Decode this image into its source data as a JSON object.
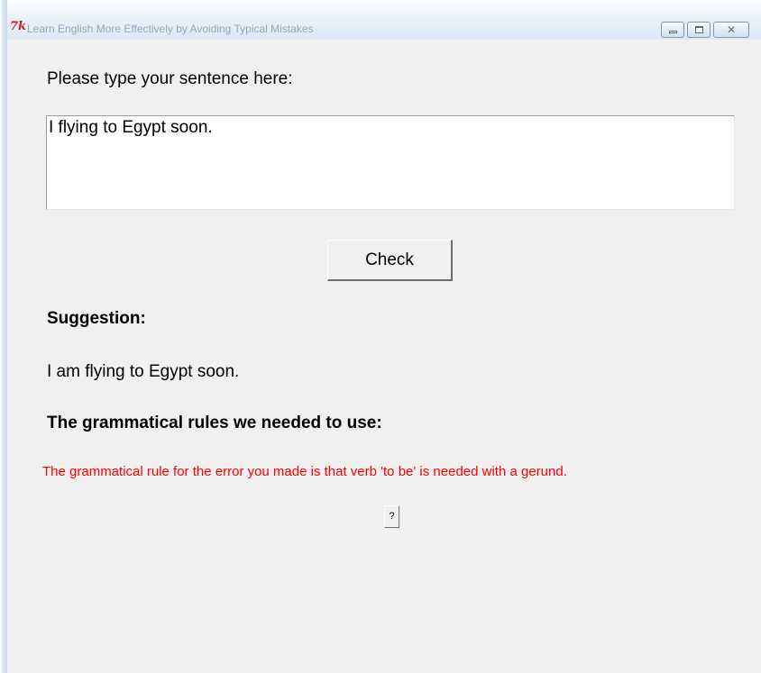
{
  "window": {
    "title": "Learn English More Effectively by Avoiding Typical Mistakes",
    "app_icon": "tk-feather-icon",
    "controls": {
      "minimize": "minimize-icon",
      "maximize": "maximize-icon",
      "close": "close-icon",
      "close_glyph": "✕"
    }
  },
  "main": {
    "prompt_label": "Please type your sentence here:",
    "input_value": "I flying to Egypt soon.",
    "check_label": "Check",
    "suggestion_heading": "Suggestion:",
    "suggestion_text": "I am flying to Egypt soon.",
    "rules_heading": "The grammatical rules we needed to use:",
    "rule_text": "The grammatical rule for the error you made is that verb 'to be' is needed with a gerund.",
    "help_label": "?"
  },
  "colors": {
    "background": "#f0f0f0",
    "rule_text": "#ff0000",
    "logo": "#d6181e"
  }
}
